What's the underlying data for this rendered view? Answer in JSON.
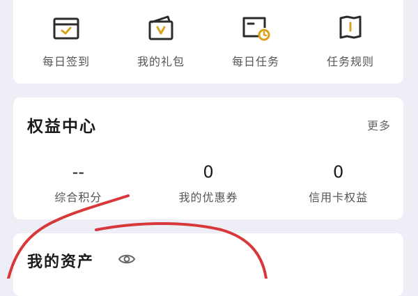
{
  "quick_actions": [
    {
      "label": "每日签到",
      "icon": "calendar-check-icon"
    },
    {
      "label": "我的礼包",
      "icon": "gift-bag-icon"
    },
    {
      "label": "每日任务",
      "icon": "task-clock-icon"
    },
    {
      "label": "任务规则",
      "icon": "rulebook-icon"
    }
  ],
  "benefits": {
    "title": "权益中心",
    "more": "更多",
    "stats": [
      {
        "value": "--",
        "label": "综合积分"
      },
      {
        "value": "0",
        "label": "我的优惠券"
      },
      {
        "value": "0",
        "label": "信用卡权益"
      }
    ]
  },
  "assets": {
    "title": "我的资产",
    "visibility_icon": "eye-icon"
  },
  "colors": {
    "background": "#eeeef7",
    "icon_dark": "#2b2b2b",
    "icon_accent": "#d9a21b",
    "annotation": "#d9383a"
  }
}
